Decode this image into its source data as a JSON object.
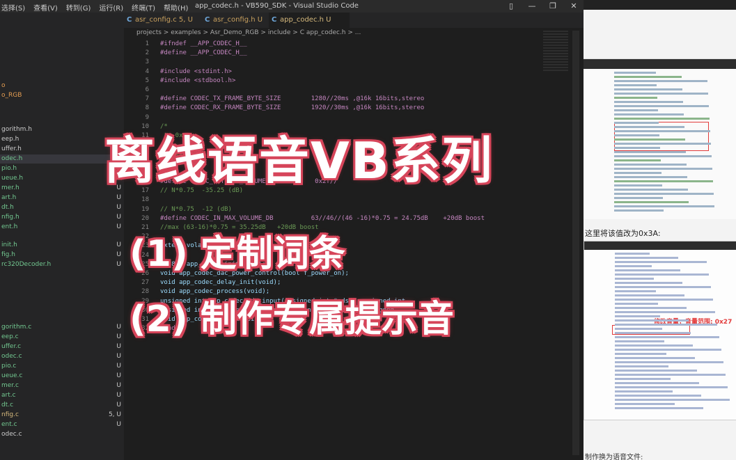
{
  "window": {
    "title": "app_codec.h - VB590_SDK - Visual Studio Code",
    "menu": [
      "选择(S)",
      "查看(V)",
      "转到(G)",
      "运行(R)",
      "终端(T)",
      "帮助(H)"
    ],
    "controls": [
      "▯",
      "—",
      "❐",
      "✕"
    ]
  },
  "tabs": [
    {
      "label": "asr_config.c 5, U"
    },
    {
      "label": "asr_config.h U"
    },
    {
      "label": "app_codec.h U"
    }
  ],
  "breadcrumb": "projects > examples > Asr_Demo_RGB > include > C app_codec.h > ...",
  "sidebar": [
    {
      "name": "o",
      "badge": ""
    },
    {
      "name": "o_RGB",
      "badge": ""
    },
    {
      "name": "gorithm.h",
      "badge": ""
    },
    {
      "name": "eep.h",
      "badge": ""
    },
    {
      "name": "uffer.h",
      "badge": ""
    },
    {
      "name": "odec.h",
      "badge": "U"
    },
    {
      "name": "pio.h",
      "badge": "U"
    },
    {
      "name": "ueue.h",
      "badge": "U"
    },
    {
      "name": "mer.h",
      "badge": "U"
    },
    {
      "name": "art.h",
      "badge": "U"
    },
    {
      "name": "dt.h",
      "badge": "U"
    },
    {
      "name": "nfig.h",
      "badge": "U"
    },
    {
      "name": "ent.h",
      "badge": "U"
    },
    {
      "name": "init.h",
      "badge": "U"
    },
    {
      "name": "fig.h",
      "badge": "U"
    },
    {
      "name": "rc320Decoder.h",
      "badge": "U"
    },
    {
      "name": "gorithm.c",
      "badge": "U"
    },
    {
      "name": "eep.c",
      "badge": "U"
    },
    {
      "name": "uffer.c",
      "badge": "U"
    },
    {
      "name": "odec.c",
      "badge": "U"
    },
    {
      "name": "pio.c",
      "badge": "U"
    },
    {
      "name": "ueue.c",
      "badge": "U"
    },
    {
      "name": "mer.c",
      "badge": "U"
    },
    {
      "name": "art.c",
      "badge": "U"
    },
    {
      "name": "dt.c",
      "badge": "U"
    },
    {
      "name": "nfig.c",
      "badge": "5, U"
    },
    {
      "name": "ent.c",
      "badge": "U"
    },
    {
      "name": "odec.c",
      "badge": ""
    }
  ],
  "code_lines": [
    {
      "n": "1",
      "t": "#ifndef __APP_CODEC_H__"
    },
    {
      "n": "2",
      "t": "#define __APP_CODEC_H__"
    },
    {
      "n": "3",
      "t": ""
    },
    {
      "n": "4",
      "t": "#include <stdint.h>"
    },
    {
      "n": "5",
      "t": "#include <stdbool.h>"
    },
    {
      "n": "6",
      "t": ""
    },
    {
      "n": "7",
      "t": "#define CODEC_TX_FRAME_BYTE_SIZE        1280//20ms ,@16k 16bits,stereo"
    },
    {
      "n": "8",
      "t": "#define CODEC_RX_FRAME_BYTE_SIZE        1920//30ms ,@16k 16bits,stereo"
    },
    {
      "n": "9",
      "t": ""
    },
    {
      "n": "10",
      "t": "/*"
    },
    {
      "n": "11",
      "t": " *  0x"
    },
    {
      "n": "12",
      "t": " *"
    },
    {
      "n": "13",
      "t": " *  0x2"
    },
    {
      "n": "14",
      "t": " *"
    },
    {
      "n": "15",
      "t": " */"
    },
    {
      "n": "16",
      "t": "#define CODEC_OUT_MAX_VOLUME_DB          0x2f//"
    },
    {
      "n": "17",
      "t": "// N*0.75  -35.25 (dB)"
    },
    {
      "n": "18",
      "t": ""
    },
    {
      "n": "19",
      "t": "// N*0.75  -12 (dB)"
    },
    {
      "n": "20",
      "t": "#define CODEC_IN_MAX_VOLUME_DB          63//46//(46 -16)*0.75 = 24.75dB    +20dB boost"
    },
    {
      "n": "21",
      "t": "//max (63-16)*0.75 = 35.25dB   +20dB boost"
    },
    {
      "n": "22",
      "t": ""
    },
    {
      "n": "23",
      "t": "extern volatile unsigned char"
    },
    {
      "n": "24",
      "t": ""
    },
    {
      "n": "25",
      "t": "int8_t app_codec_init(void);"
    },
    {
      "n": "26",
      "t": "void app_codec_dac_power_control(bool f_power_on);"
    },
    {
      "n": "27",
      "t": "void app_codec_delay_init(void);"
    },
    {
      "n": "28",
      "t": "void app_codec_process(void);"
    },
    {
      "n": "29",
      "t": "unsigned int app_codec_adc_input(unsigned int *pdst, unsigned int"
    },
    {
      "n": "30",
      "t": "unsigned int app_codec_dac_output(unsigned int *psrc, unsigned"
    },
    {
      "n": "31",
      "t": "void app_codec_uninit(void);"
    },
    {
      "n": "32",
      "t": "#endif"
    }
  ],
  "overlay": {
    "title": "离线语音VB系列",
    "line1": "(1) 定制词条",
    "line2": "(2) 制作专属提示音"
  },
  "right_panel": {
    "note": "这里将该值改为0x3A:",
    "inner_note": "修改音量，音量范围: 0x27",
    "tail": "制作换为语音文件:"
  },
  "colors": {
    "overlay_outline": "#d6455a",
    "overlay_fill": "#ffffff",
    "accent_red": "#e23b3b"
  }
}
